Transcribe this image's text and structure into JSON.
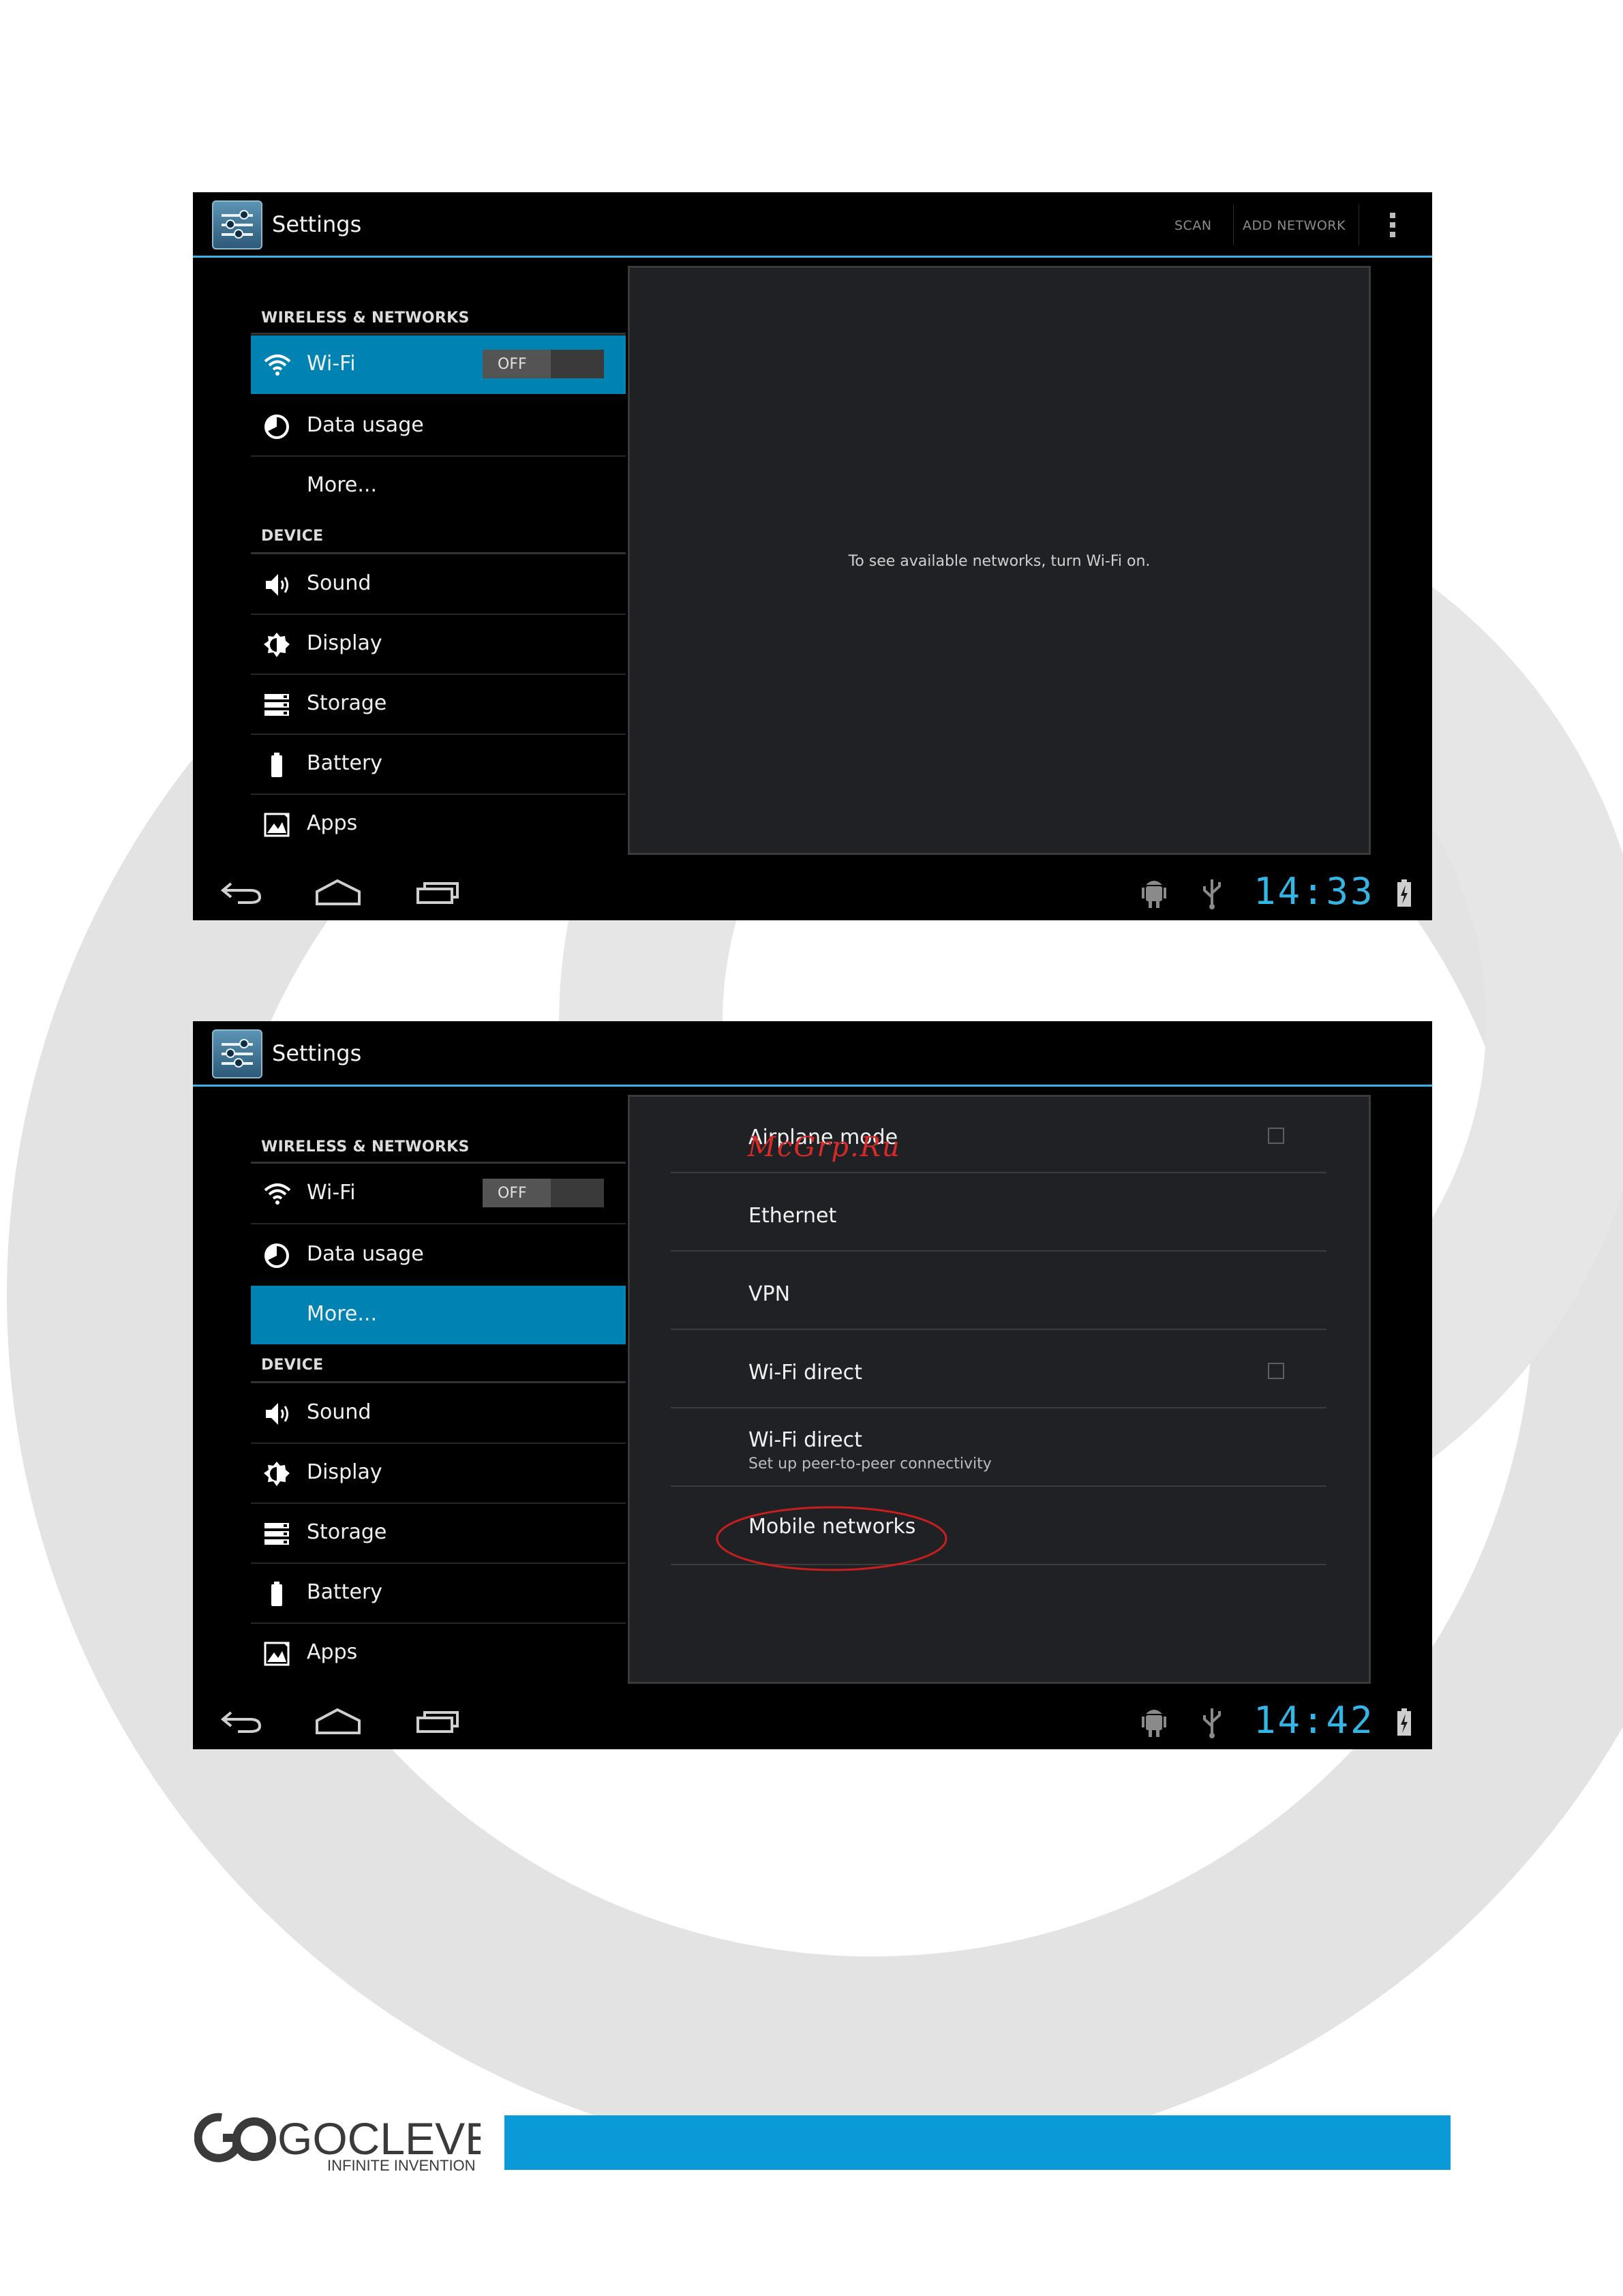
{
  "screens": [
    {
      "app_title": "Settings",
      "action_bar_actions": [
        "SCAN",
        "ADD NETWORK"
      ],
      "sections": [
        {
          "header": "WIRELESS & NETWORKS",
          "items": [
            {
              "label": "Wi-Fi",
              "icon": "wifi-icon",
              "toggle": "OFF",
              "selected": true
            },
            {
              "label": "Data usage",
              "icon": "data-usage-icon"
            },
            {
              "label": "More...",
              "icon": ""
            }
          ]
        },
        {
          "header": "DEVICE",
          "items": [
            {
              "label": "Sound",
              "icon": "speaker-icon"
            },
            {
              "label": "Display",
              "icon": "brightness-icon"
            },
            {
              "label": "Storage",
              "icon": "storage-icon"
            },
            {
              "label": "Battery",
              "icon": "battery-icon"
            },
            {
              "label": "Apps",
              "icon": "apps-icon"
            }
          ]
        }
      ],
      "detail_message": "To see available networks, turn Wi-Fi on.",
      "clock": "14:33"
    },
    {
      "app_title": "Settings",
      "sections": [
        {
          "header": "WIRELESS & NETWORKS",
          "items": [
            {
              "label": "Wi-Fi",
              "icon": "wifi-icon",
              "toggle": "OFF"
            },
            {
              "label": "Data usage",
              "icon": "data-usage-icon"
            },
            {
              "label": "More...",
              "icon": "",
              "selected": true
            }
          ]
        },
        {
          "header": "DEVICE",
          "items": [
            {
              "label": "Sound",
              "icon": "speaker-icon"
            },
            {
              "label": "Display",
              "icon": "brightness-icon"
            },
            {
              "label": "Storage",
              "icon": "storage-icon"
            },
            {
              "label": "Battery",
              "icon": "battery-icon"
            },
            {
              "label": "Apps",
              "icon": "apps-icon"
            }
          ]
        }
      ],
      "more_options": [
        {
          "title": "Airplane mode",
          "checkbox": true
        },
        {
          "title": "Ethernet"
        },
        {
          "title": "VPN"
        },
        {
          "title": "Wi-Fi direct",
          "checkbox": true
        },
        {
          "title": "Wi-Fi direct",
          "subtitle": "Set up peer-to-peer connectivity"
        },
        {
          "title": "Mobile networks",
          "highlighted": true
        }
      ],
      "clock": "14:42"
    }
  ],
  "watermark": "McGrp.Ru",
  "footer": {
    "brand": "GOCLEVER",
    "tagline": "INFINITE INVENTION"
  },
  "colors": {
    "accent": "#33b5e5",
    "selected": "#0083b3",
    "footer_bar": "#0a9ad8",
    "annotation": "#c81e1e"
  }
}
